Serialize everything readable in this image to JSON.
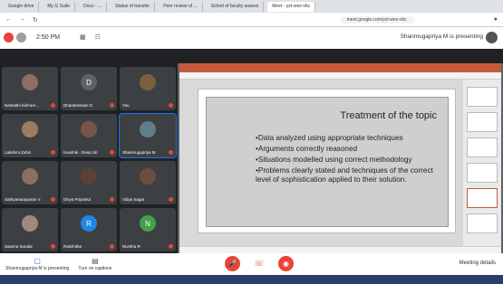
{
  "browser": {
    "tabs": [
      "Meet - yzt-wez-vbc",
      "Sched of faculty assess",
      "Peer review of ...",
      "Status of transfer",
      "Docs - ...",
      "My G Suite",
      "Google drive"
    ],
    "url": "meet.google.com/yzt-wez-vbc"
  },
  "meet": {
    "time": "2:50 PM",
    "presenting_status": "Shanmugapriya M is presenting",
    "participants": [
      {
        "name": "You",
        "initial": "",
        "color": "#7b5e3b"
      },
      {
        "name": "Dharakeswari D",
        "initial": "D",
        "color": "#5f6368"
      },
      {
        "name": "Nalmathi Kishore...",
        "initial": "",
        "color": "#8d6e63"
      },
      {
        "name": "Shanmugapriya M",
        "initial": "",
        "color": "#607d8b"
      },
      {
        "name": "Koushik - Deep Sri",
        "initial": "",
        "color": "#795548"
      },
      {
        "name": "Lakshmi Zubin",
        "initial": "",
        "color": "#9e7b5e"
      },
      {
        "name": "Vidya Sagar",
        "initial": "",
        "color": "#6d4c41"
      },
      {
        "name": "Divya Priyanka",
        "initial": "",
        "color": "#5d4037"
      },
      {
        "name": "Sathyanarayanan V",
        "initial": "",
        "color": "#8d6e63"
      },
      {
        "name": "Nivetha R",
        "initial": "N",
        "color": "#43a047"
      },
      {
        "name": "Rakshitha",
        "initial": "R",
        "color": "#1e88e5"
      },
      {
        "name": "Swarna Sundar",
        "initial": "",
        "color": "#a1887f"
      }
    ]
  },
  "slide": {
    "heading": "Treatment of the topic",
    "bullets": [
      "•Data analyzed using appropriate techniques",
      "•Arguments correctly reasoned",
      "•Situations modelled using correct methodology",
      "•Problems clearly stated and techniques of the correct level of sophistication applied to their solution."
    ]
  },
  "controls": {
    "presenting_label": "Shanmugapriya M is presenting",
    "captions_label": "Turn on captions",
    "meeting_details": "Meeting details"
  }
}
